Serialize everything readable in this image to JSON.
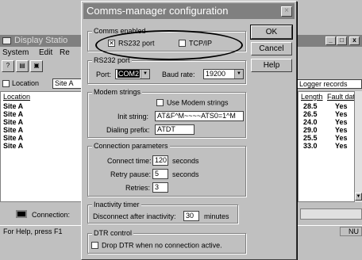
{
  "background_window": {
    "title": "Display Statio",
    "menu": {
      "system": "System",
      "edit": "Edit",
      "extra": "Re"
    },
    "toolbar_icons": [
      "help-book-icon",
      "print-icon",
      "display-icon"
    ],
    "location": {
      "label": "Location",
      "value": "Site A",
      "checked": false
    },
    "list_header": "Location",
    "list_rows": [
      "Site A",
      "Site A",
      "Site A",
      "Site A",
      "Site A",
      "Site A"
    ],
    "logger_combo": "Logger records",
    "right_columns": [
      "Length",
      "Fault data"
    ],
    "right_rows": [
      {
        "length": "28.5",
        "fault": "Yes"
      },
      {
        "length": "26.5",
        "fault": "Yes"
      },
      {
        "length": "24.0",
        "fault": "Yes"
      },
      {
        "length": "29.0",
        "fault": "Yes"
      },
      {
        "length": "25.5",
        "fault": "Yes"
      },
      {
        "length": "33.0",
        "fault": "Yes"
      }
    ],
    "connection_label": "Connection:",
    "status_text": "For Help, press F1",
    "status_right": "NU"
  },
  "dialog": {
    "title": "Comms-manager configuration",
    "close_glyph": "×",
    "buttons": {
      "ok": "OK",
      "cancel": "Cancel",
      "help": "Help"
    },
    "comms_enabled": {
      "label": "Comms enabled",
      "rs232": {
        "label": "RS232 port",
        "checked": true
      },
      "tcpip": {
        "label": "TCP/IP",
        "checked": false
      }
    },
    "rs232_port": {
      "label": "RS232 port",
      "port_label": "Port:",
      "port_value": "COM2",
      "baud_label": "Baud rate:",
      "baud_value": "19200"
    },
    "modem_strings": {
      "label": "Modem strings",
      "use_label": "Use Modem strings",
      "use_checked": false,
      "init_label": "Init string:",
      "init_value": "AT&F^M~~~~ATS0=1^M",
      "prefix_label": "Dialing prefix:",
      "prefix_value": "ATDT"
    },
    "connection_params": {
      "label": "Connection parameters",
      "connect_label": "Connect time:",
      "connect_value": "120",
      "connect_unit": "seconds",
      "retry_label": "Retry pause:",
      "retry_value": "5",
      "retry_unit": "seconds",
      "retries_label": "Retries:",
      "retries_value": "3"
    },
    "inactivity": {
      "label": "Inactivity timer",
      "disconnect_label": "Disconnect after inactivity:",
      "disconnect_value": "30",
      "disconnect_unit": "minutes"
    },
    "dtr": {
      "label": "DTR control",
      "drop_label": "Drop DTR when no connection active.",
      "drop_checked": false
    }
  }
}
